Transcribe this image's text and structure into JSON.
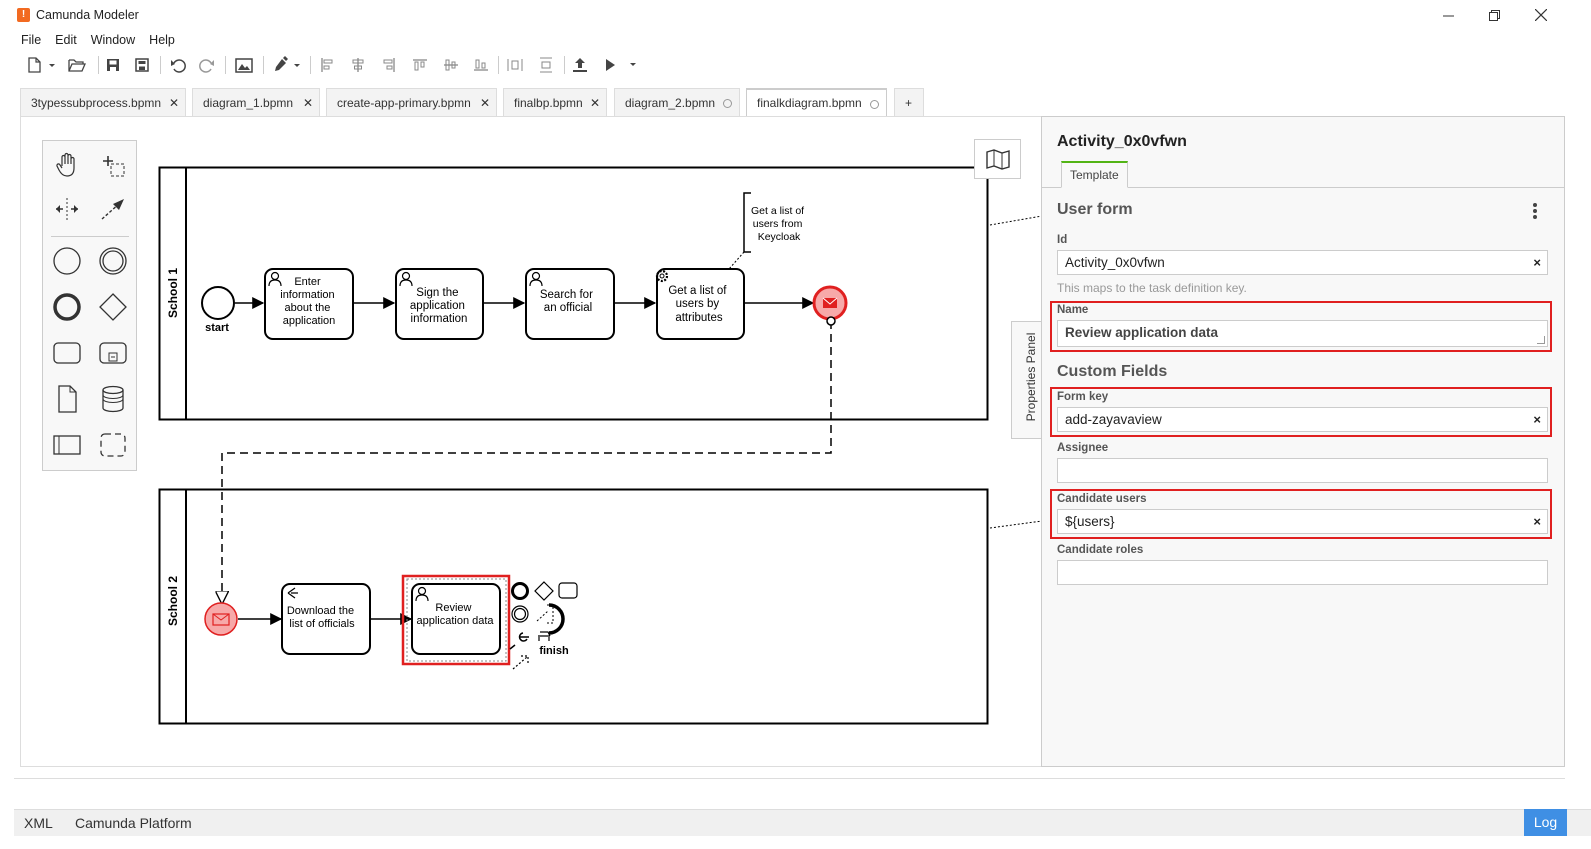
{
  "window": {
    "title": "Camunda Modeler",
    "logo_glyph": "!",
    "controls": [
      "minimize-icon",
      "restore-icon",
      "close-icon"
    ]
  },
  "menu": [
    "File",
    "Edit",
    "Window",
    "Help"
  ],
  "toolbar_icons": [
    "new-file-icon",
    "open-folder-icon",
    "save-icon",
    "save-all-icon",
    "undo-icon",
    "redo-icon",
    "export-image-icon",
    "color-brush-icon",
    "align-left-icon",
    "align-center-icon",
    "align-right-icon",
    "align-top-icon",
    "align-middle-icon",
    "align-bottom-icon",
    "distribute-horizontal-icon",
    "distribute-vertical-icon",
    "deploy-icon",
    "run-icon"
  ],
  "tabs": [
    {
      "label": "3typessubprocess.bpmn",
      "state": "close"
    },
    {
      "label": "diagram_1.bpmn",
      "state": "close"
    },
    {
      "label": "create-app-primary.bpmn",
      "state": "close"
    },
    {
      "label": "finalbp.bpmn",
      "state": "close"
    },
    {
      "label": "diagram_2.bpmn",
      "state": "dirty"
    },
    {
      "label": "finalkdiagram.bpmn",
      "state": "dirty",
      "active": true
    }
  ],
  "new_tab_label": "+",
  "palette_tools": [
    "hand-tool-icon",
    "lasso-tool-icon",
    "space-tool-icon",
    "connect-tool-icon",
    "start-event-icon",
    "intermediate-event-icon",
    "end-event-icon",
    "gateway-icon",
    "task-icon",
    "subprocess-icon",
    "data-object-icon",
    "data-store-icon",
    "pool-icon",
    "group-icon"
  ],
  "diagram": {
    "lane1": "School 1",
    "lane2": "School 2",
    "start_label": "start",
    "task1": [
      "Enter",
      "information",
      "about the",
      "application"
    ],
    "task2": [
      "Sign the",
      "application",
      "information"
    ],
    "task3": [
      "Search for",
      "an official"
    ],
    "task4": [
      "Get a list of",
      "users by",
      "attributes"
    ],
    "annotation": [
      "Get a list of",
      "users from",
      "Keycloak"
    ],
    "task5": [
      "Download the",
      "list of officials"
    ],
    "task6": [
      "Review",
      "application data"
    ],
    "end_label": "finish"
  },
  "properties_panel_label": "Properties Panel",
  "props": {
    "element_id_title": "Activity_0x0vfwn",
    "tab": "Template",
    "group": "User form",
    "id_label": "Id",
    "id_value": "Activity_0x0vfwn",
    "id_hint": "This maps to the task definition key.",
    "name_label": "Name",
    "name_value": "Review application data",
    "custom_fields": "Custom Fields",
    "form_key_label": "Form key",
    "form_key_value": "add-zayavaview",
    "assignee_label": "Assignee",
    "assignee_value": "",
    "candidate_users_label": "Candidate users",
    "candidate_users_value": "${users}",
    "candidate_roles_label": "Candidate roles",
    "candidate_roles_value": "",
    "clear_glyph": "×"
  },
  "status": {
    "xml": "XML",
    "platform": "Camunda Platform",
    "log": "Log"
  },
  "colors": {
    "accent": "#52b415",
    "highlight": "#e02020",
    "message_event": "#f7a9a9",
    "log_button": "#3f8fe4"
  }
}
